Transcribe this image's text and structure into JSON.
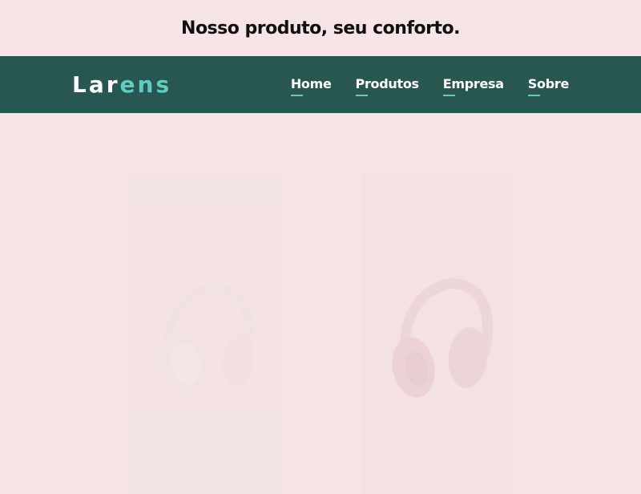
{
  "page": {
    "tagline": "Nosso produto, seu conforto."
  },
  "header": {
    "logo_main": "Lar",
    "logo_accent": "ens",
    "nav": [
      {
        "label": "Home"
      },
      {
        "label": "Produtos"
      },
      {
        "label": "Empresa"
      },
      {
        "label": "Sobre"
      }
    ]
  },
  "products": [
    {
      "image": "headphones-white"
    },
    {
      "image": "headphones-pink"
    }
  ],
  "colors": {
    "background": "#f6e4e6",
    "navbar": "#285752",
    "accent": "#5ecdc0",
    "text_dark": "#111111",
    "text_light": "#ffffff"
  }
}
